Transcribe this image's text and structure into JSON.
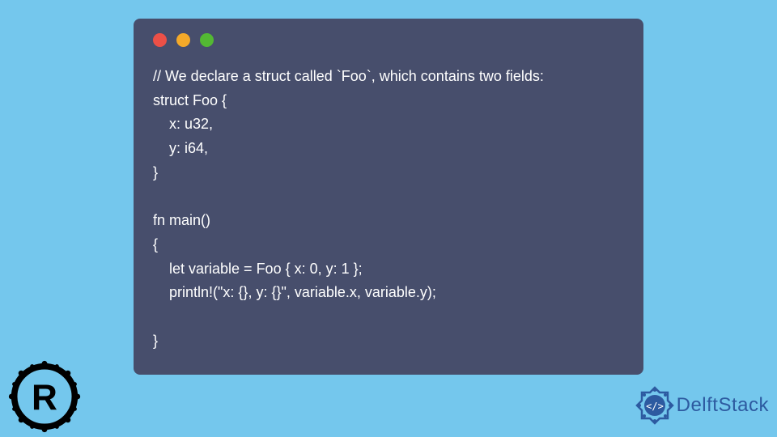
{
  "code": {
    "line1": "// We declare a struct called `Foo`, which contains two fields:",
    "line2": "struct Foo {",
    "line3": "    x: u32,",
    "line4": "    y: i64,",
    "line5": "}",
    "line6": "",
    "line7": "fn main()",
    "line8": "{",
    "line9": "    let variable = Foo { x: 0, y: 1 };",
    "line10": "    println!(\"x: {}, y: {}\", variable.x, variable.y);",
    "line11": "",
    "line12": "}"
  },
  "brand": {
    "name": "DelftStack"
  }
}
